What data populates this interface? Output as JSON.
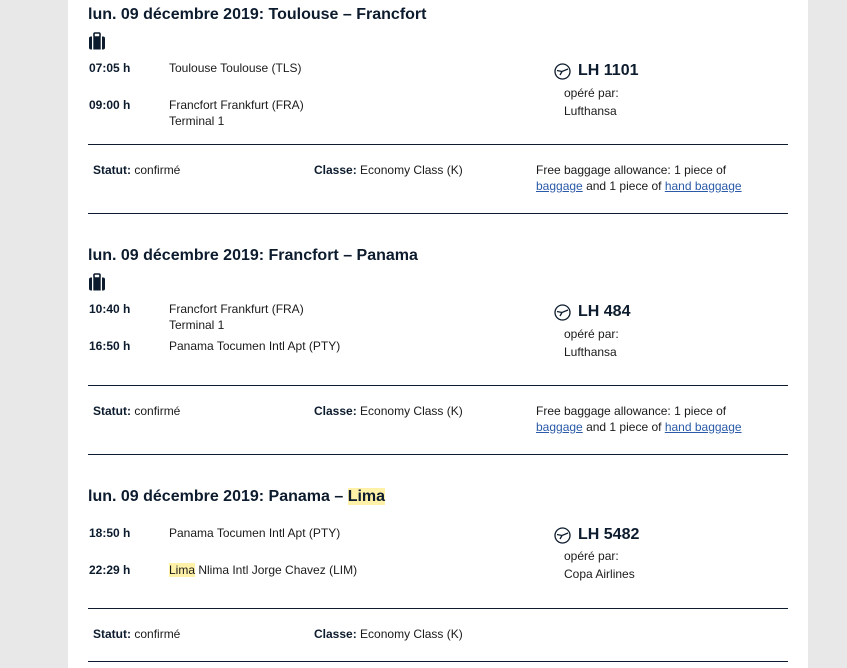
{
  "segments": [
    {
      "title": "lun. 09 décembre 2019: Toulouse – Francfort",
      "has_baggage_icon": true,
      "departure": {
        "time": "07:05 h",
        "place": "Toulouse Toulouse (TLS)",
        "terminal": ""
      },
      "arrival": {
        "time": "09:00 h",
        "place": "Francfort Frankfurt (FRA)",
        "terminal": "Terminal 1"
      },
      "flight_number": "LH 1101",
      "operated_by_label": "opéré par:",
      "operator": "Lufthansa",
      "status_label": "Statut:",
      "status": "confirmé",
      "class_label": "Classe:",
      "class": "Economy Class (K)",
      "baggage_text_1": "Free baggage allowance: 1 piece of",
      "baggage_link": "baggage",
      "baggage_text_2": "and 1 piece of",
      "hand_baggage_link": "hand baggage"
    },
    {
      "title": "lun. 09 décembre 2019: Francfort – Panama",
      "has_baggage_icon": true,
      "departure": {
        "time": "10:40 h",
        "place": "Francfort Frankfurt (FRA)",
        "terminal": "Terminal 1"
      },
      "arrival": {
        "time": "16:50 h",
        "place": "Panama Tocumen Intl Apt (PTY)",
        "terminal": ""
      },
      "flight_number": "LH 484",
      "operated_by_label": "opéré par:",
      "operator": "Lufthansa",
      "status_label": "Statut:",
      "status": "confirmé",
      "class_label": "Classe:",
      "class": "Economy Class (K)",
      "baggage_text_1": "Free baggage allowance: 1 piece of",
      "baggage_link": "baggage",
      "baggage_text_2": "and 1 piece of",
      "hand_baggage_link": "hand baggage"
    },
    {
      "title_prefix": "lun. 09 décembre 2019: Panama – ",
      "title_highlight": "Lima",
      "has_baggage_icon": false,
      "departure": {
        "time": "18:50 h",
        "place": "Panama Tocumen Intl Apt (PTY)",
        "terminal": ""
      },
      "arrival": {
        "time": "22:29 h",
        "place_highlight": "Lima",
        "place_rest": " Nlima Intl Jorge Chavez (LIM)",
        "terminal": ""
      },
      "flight_number": "LH 5482",
      "operated_by_label": "opéré par:",
      "operator": "Copa Airlines",
      "status_label": "Statut:",
      "status": "confirmé",
      "class_label": "Classe:",
      "class": "Economy Class (K)"
    }
  ],
  "colors": {
    "text_dark": "#0c1b2d",
    "link": "#2a5aa8",
    "highlight": "#fff2a8",
    "frame": "#e8e8e8"
  },
  "icons": {
    "baggage": "suitcase-icon",
    "airline": "lufthansa-crane-icon"
  }
}
